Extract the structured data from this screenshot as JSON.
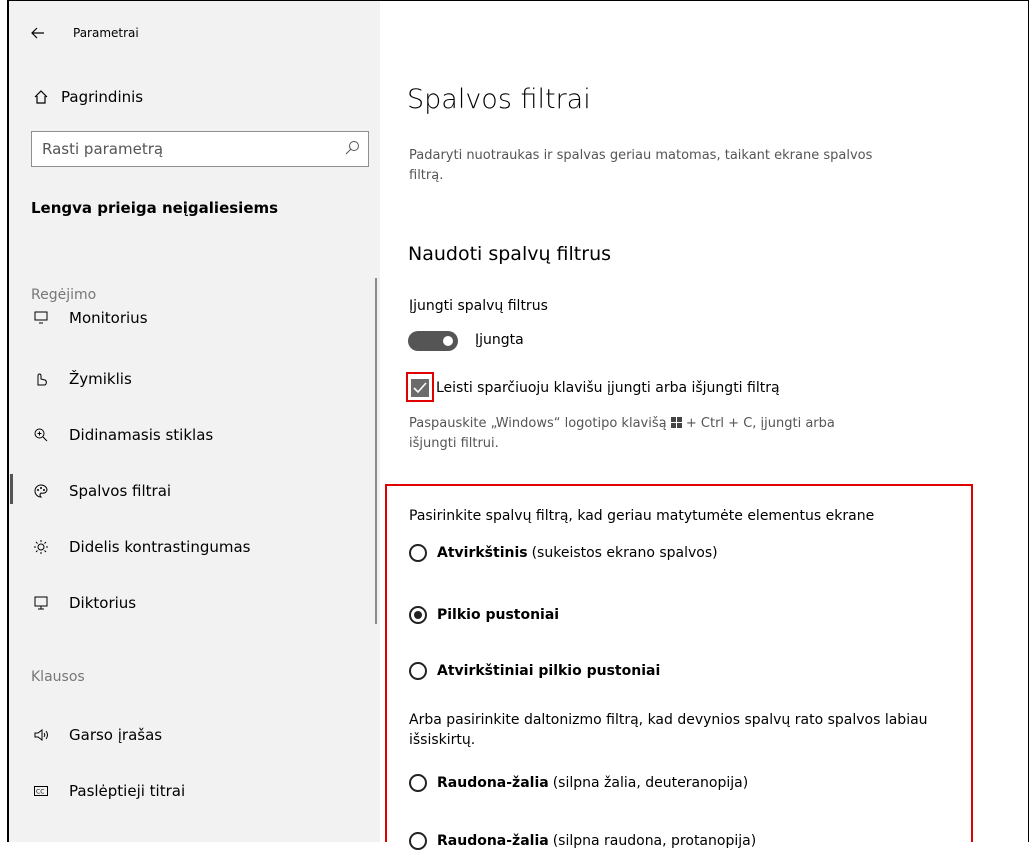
{
  "app": {
    "title": "Parametrai"
  },
  "sidebar": {
    "home": "Pagrindinis",
    "search_placeholder": "Rasti parametrą",
    "section": "Lengva prieiga neįgaliesiems",
    "group_vision": "Regėjimo",
    "items_vision": [
      {
        "label": "Monitorius",
        "icon": "monitor-icon"
      },
      {
        "label": "Žymiklis",
        "icon": "pointer-icon"
      },
      {
        "label": "Didinamasis stiklas",
        "icon": "magnifier-icon"
      },
      {
        "label": "Spalvos filtrai",
        "icon": "palette-icon",
        "selected": true
      },
      {
        "label": "Didelis kontrastingumas",
        "icon": "contrast-icon"
      },
      {
        "label": "Diktorius",
        "icon": "narrator-icon"
      }
    ],
    "group_hearing": "Klausos",
    "items_hearing": [
      {
        "label": "Garso įrašas",
        "icon": "speaker-icon"
      },
      {
        "label": "Paslėptieji titrai",
        "icon": "captions-icon"
      }
    ]
  },
  "main": {
    "title": "Spalvos filtrai",
    "description": "Padaryti nuotraukas ir spalvas geriau matomas, taikant ekrane spalvos filtrą.",
    "subtitle": "Naudoti spalvų filtrus",
    "toggle_label": "Įjungti spalvų filtrus",
    "toggle_state": "Įjungta",
    "checkbox_label": "Leisti sparčiuoju klavišu įjungti arba išjungti filtrą",
    "checkbox_checked": true,
    "shortcut_hint_1": "Paspauskite „Windows“ logotipo klavišą",
    "shortcut_hint_2": "+ Ctrl + C, įjungti arba",
    "shortcut_hint_3": "išjungti filtrui.",
    "choose_filter": "Pasirinkite spalvų filtrą, kad geriau matytumėte elementus ekrane",
    "filters": [
      {
        "label": "Atvirkštinis",
        "desc": "(sukeistos ekrano spalvos)",
        "selected": false
      },
      {
        "label": "Pilkio pustoniai",
        "desc": "",
        "selected": true
      },
      {
        "label": "Atvirkštiniai pilkio pustoniai",
        "desc": "",
        "selected": false
      }
    ],
    "colorblind_text": "Arba pasirinkite daltonizmo filtrą, kad devynios spalvų rato spalvos labiau išsiskirtų.",
    "colorblind_filters": [
      {
        "label": "Raudona-žalia",
        "desc": "(silpna žalia, deuteranopija)",
        "selected": false
      },
      {
        "label": "Raudona-žalia",
        "desc": "(silpna raudona, protanopija)",
        "selected": false
      }
    ]
  },
  "colors": {
    "highlight": "#e00000",
    "toggle_on": "#555555",
    "sidebar_bg": "#f2f2f2"
  }
}
